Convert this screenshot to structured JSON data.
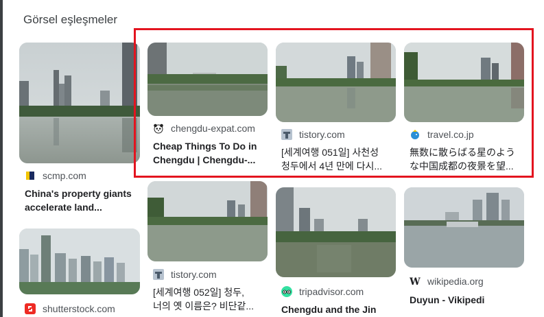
{
  "section": {
    "title": "Görsel eşleşmeler"
  },
  "colors": {
    "highlight": "#e3141f",
    "text": "#202124",
    "source_text": "#4d5156"
  },
  "cards": [
    {
      "source": "scmp.com",
      "favicon": "scmp-icon",
      "title_line1": "China's property giants",
      "title_line2": "accelerate land..."
    },
    {
      "source": "chengdu-expat.com",
      "favicon": "panda-icon",
      "title_line1": "Cheap Things To Do in",
      "title_line2": "Chengdu | Chengdu-..."
    },
    {
      "source": "tistory.com",
      "favicon": "tistory-icon",
      "title_line1": "[세계여행 051일] 사천성",
      "title_line2": "청두에서 4년 만에 다시..."
    },
    {
      "source": "travel.co.jp",
      "favicon": "travel-bird-icon",
      "title_line1": "無数に散らばる星のよう",
      "title_line2": "な中国成都の夜景を望..."
    },
    {
      "source": "shutterstock.com",
      "favicon": "shutterstock-icon",
      "title_line1": "",
      "title_line2": ""
    },
    {
      "source": "tistory.com",
      "favicon": "tistory-icon",
      "title_line1": "[세계여행 052일] 청두,",
      "title_line2": "너의 옛 이름은? 비단같..."
    },
    {
      "source": "tripadvisor.com",
      "favicon": "tripadvisor-icon",
      "title_line1": "Chengdu and the Jin",
      "title_line2": ""
    },
    {
      "source": "wikipedia.org",
      "favicon": "wikipedia-icon",
      "title_line1": "Duyun - Vikipedi",
      "title_line2": ""
    }
  ]
}
